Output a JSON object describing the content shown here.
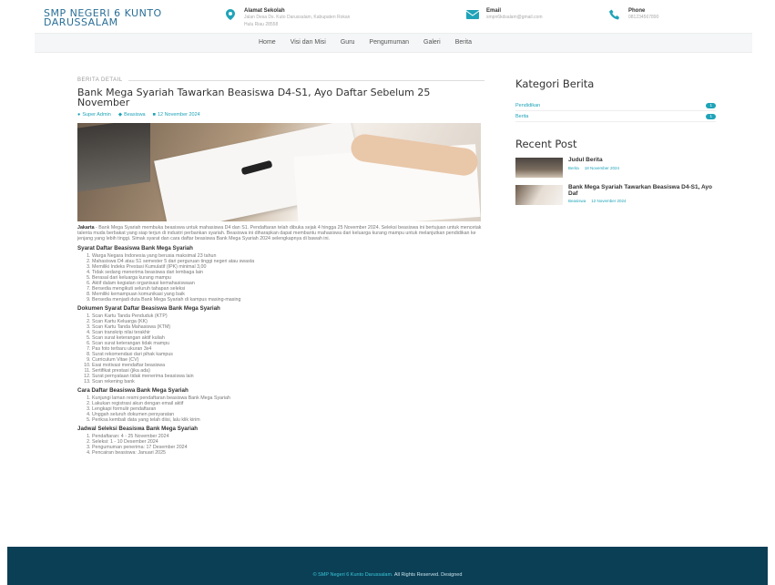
{
  "header": {
    "logo_line1": "SMP NEGERI 6 KUNTO",
    "logo_line2": "DARUSSALAM",
    "address": {
      "icon": "map-pin-icon",
      "label": "Alamat Sekolah",
      "value_line1": "Jalan Desa Ds. Kuto Darussalam, Kabupaten Rokan",
      "value_line2": "Hulu Riau 28558"
    },
    "email": {
      "icon": "mail-icon",
      "label": "Email",
      "value": "smpn6kdsalam@gmail.com"
    },
    "phone": {
      "icon": "phone-icon",
      "label": "Phone",
      "value": "081234567890"
    }
  },
  "nav": {
    "items": [
      "Home",
      "Visi dan Misi",
      "Guru",
      "Pengumuman",
      "Galeri",
      "Berita"
    ]
  },
  "article": {
    "kicker": "BERITA DETAIL",
    "title": "Bank Mega Syariah Tawarkan Beasiswa D4-S1, Ayo Daftar Sebelum 25 November",
    "meta_author": "Super Admin",
    "meta_category": "Beasiswa",
    "meta_date": "12 November 2024",
    "intro_lead": "Jakarta",
    "intro_text": " - Bank Mega Syariah membuka beasiswa untuk mahasiswa D4 dan S1. Pendaftaran telah dibuka sejak 4 hingga 25 November 2024. Seleksi beasiswa ini bertujuan untuk mencetak talenta muda berbakat yang siap terjun di industri perbankan syariah. Beasiswa ini diharapkan dapat membantu mahasiswa dari keluarga kurang mampu untuk melanjutkan pendidikan ke jenjang yang lebih tinggi. Simak syarat dan cara daftar beasiswa Bank Mega Syariah 2024 selengkapnya di bawah ini.",
    "sec1_title": "Syarat Daftar Beasiswa Bank Mega Syariah",
    "sec1_items": [
      "Warga Negara Indonesia yang berusia maksimal 23 tahun",
      "Mahasiswa D4 atau S1 semester 5 dari perguruan tinggi negeri atau swasta",
      "Memiliki Indeks Prestasi Kumulatif (IPK) minimal 3,00",
      "Tidak sedang menerima beasiswa dari lembaga lain",
      "Berasal dari keluarga kurang mampu",
      "Aktif dalam kegiatan organisasi kemahasiswaan",
      "Bersedia mengikuti seluruh tahapan seleksi",
      "Memiliki kemampuan komunikasi yang baik",
      "Bersedia menjadi duta Bank Mega Syariah di kampus masing-masing"
    ],
    "sec2_title": "Dokumen Syarat Daftar Beasiswa Bank Mega Syariah",
    "sec2_items": [
      "Scan Kartu Tanda Penduduk (KTP)",
      "Scan Kartu Keluarga (KK)",
      "Scan Kartu Tanda Mahasiswa (KTM)",
      "Scan transkrip nilai terakhir",
      "Scan surat keterangan aktif kuliah",
      "Scan surat keterangan tidak mampu",
      "Pas foto terbaru ukuran 3x4",
      "Surat rekomendasi dari pihak kampus",
      "Curriculum Vitae (CV)",
      "Esai motivasi mendaftar beasiswa",
      "Sertifikat prestasi (jika ada)",
      "Surat pernyataan tidak menerima beasiswa lain",
      "Scan rekening bank"
    ],
    "sec3_title": "Cara Daftar Beasiswa Bank Mega Syariah",
    "sec3_items": [
      "Kunjungi laman resmi pendaftaran beasiswa Bank Mega Syariah",
      "Lakukan registrasi akun dengan email aktif",
      "Lengkapi formulir pendaftaran",
      "Unggah seluruh dokumen persyaratan",
      "Periksa kembali data yang telah diisi, lalu klik kirim"
    ],
    "sec4_title": "Jadwal Seleksi Beasiswa Bank Mega Syariah",
    "sec4_items": [
      "Pendaftaran: 4 - 25 November 2024",
      "Seleksi: 1 - 10 Desember 2024",
      "Pengumuman penerima: 17 Desember 2024",
      "Pencairan beasiswa: Januari 2025"
    ]
  },
  "sidebar": {
    "categories_title": "Kategori Berita",
    "categories": [
      {
        "label": "Pendidikan",
        "count": "1"
      },
      {
        "label": "Berita",
        "count": "1"
      }
    ],
    "recent_title": "Recent Post",
    "posts": [
      {
        "title": "Judul Berita",
        "category": "Berita",
        "date": "18 November 2024"
      },
      {
        "title": "Bank Mega Syariah Tawarkan Beasiswa D4-S1, Ayo Daf",
        "category": "Beasiswa",
        "date": "12 November 2024"
      }
    ]
  },
  "footer": {
    "copyright_prefix": "© SMP Negeri 6 Kunto Darussalam.",
    "copyright_suffix": " All Rights Reserved. Designed"
  }
}
